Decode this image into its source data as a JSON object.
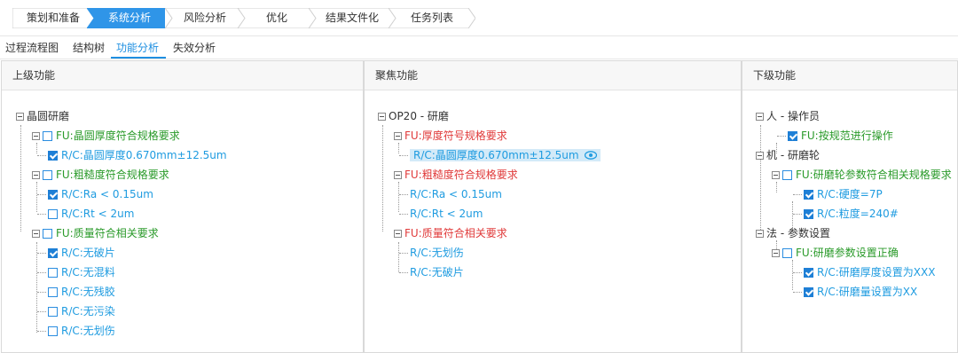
{
  "steps": [
    {
      "label": "策划和准备",
      "active": false
    },
    {
      "label": "系统分析",
      "active": true
    },
    {
      "label": "风险分析",
      "active": false
    },
    {
      "label": "优化",
      "active": false
    },
    {
      "label": "结果文件化",
      "active": false
    },
    {
      "label": "任务列表",
      "active": false
    }
  ],
  "subtabs": [
    "过程流程图",
    "结构树",
    "功能分析",
    "失效分析"
  ],
  "panels": {
    "upper": {
      "title": "上级功能",
      "root": "晶圆研磨",
      "fu1": "FU:晶圆厚度符合规格要求",
      "rc1": "R/C:晶圆厚度0.670mm±12.5um",
      "fu2": "FU:粗糙度符合规格要求",
      "rc2a": "R/C:Ra < 0.15um",
      "rc2b": "R/C:Rt < 2um",
      "fu3": "FU:质量符合相关要求",
      "rc3a": "R/C:无破片",
      "rc3b": "R/C:无混料",
      "rc3c": "R/C:无残胶",
      "rc3d": "R/C:无污染",
      "rc3e": "R/C:无划伤"
    },
    "focus": {
      "title": "聚焦功能",
      "root": "OP20 - 研磨",
      "fu1": "FU:厚度符号规格要求",
      "rc1": "R/C:晶圆厚度0.670mm±12.5um",
      "fu2": "FU:粗糙度符合规格要求",
      "rc2a": "R/C:Ra < 0.15um",
      "rc2b": "R/C:Rt < 2um",
      "fu3": "FU:质量符合相关要求",
      "rc3a": "R/C:无划伤",
      "rc3b": "R/C:无破片"
    },
    "lower": {
      "title": "下级功能",
      "man": "人 - 操作员",
      "man_fu": "FU:按规范进行操作",
      "machine": "机 - 研磨轮",
      "machine_fu": "FU:研磨轮参数符合相关规格要求",
      "machine_rc1": "R/C:硬度=7P",
      "machine_rc2": "R/C:粒度=240#",
      "method": "法 - 参数设置",
      "method_fu": "FU:研磨参数设置正确",
      "method_rc1": "R/C:研磨厚度设置为XXX",
      "method_rc2": "R/C:研磨量设置为XX"
    }
  },
  "colors": {
    "accent": "#1e8fe1",
    "green": "#2a9a2a",
    "red": "#e03a3a",
    "blue": "#1e9be0"
  }
}
